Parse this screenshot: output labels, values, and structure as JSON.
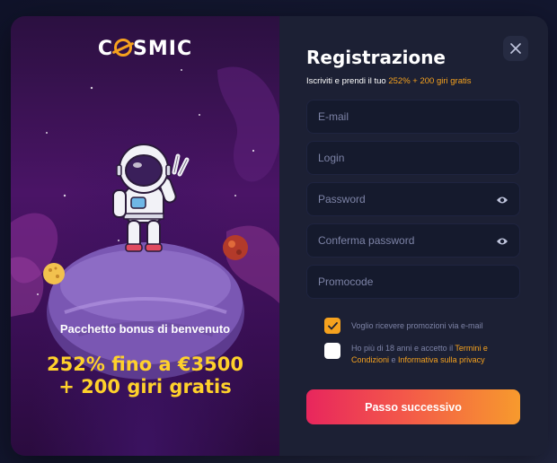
{
  "brand": {
    "logo_prefix": "C",
    "logo_suffix": "SMIC",
    "accent": "#f6a21e"
  },
  "promo": {
    "subtitle": "Pacchetto bonus di benvenuto",
    "offer_line1": "252% fino a €3500",
    "offer_line2": "+ 200 giri gratis"
  },
  "form": {
    "title": "Registrazione",
    "subline_prefix": "Iscriviti e prendi il tuo ",
    "subline_highlight": "252% + 200 giri gratis",
    "close_icon": "close-icon",
    "fields": {
      "email_placeholder": "E-mail",
      "login_placeholder": "Login",
      "password_placeholder": "Password",
      "confirm_placeholder": "Conferma password",
      "promocode_placeholder": "Promocode"
    },
    "promo_checkbox": {
      "checked": true,
      "label": "Voglio ricevere promozioni via e-mail"
    },
    "age_checkbox": {
      "checked": false,
      "text_prefix": "Ho più di 18 anni e accetto il ",
      "terms_link": "Termini e Condizioni",
      "connector": " e ",
      "privacy_link": "Informativa sulla privacy"
    },
    "submit_label": "Passo successivo"
  }
}
